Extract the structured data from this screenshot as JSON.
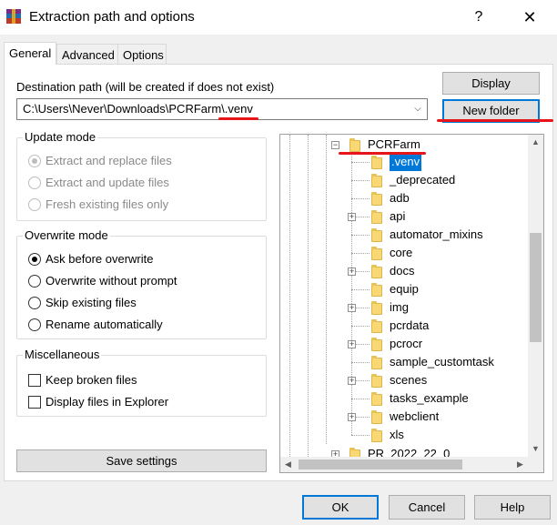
{
  "window": {
    "title": "Extraction path and options",
    "help_glyph": "?",
    "close_glyph": "✕"
  },
  "tabs": [
    {
      "label": "General",
      "active": true
    },
    {
      "label": "Advanced",
      "active": false
    },
    {
      "label": "Options",
      "active": false
    }
  ],
  "destination": {
    "label": "Destination path (will be created if does not exist)",
    "value": "C:\\Users\\Never\\Downloads\\PCRFarm\\.venv"
  },
  "buttons": {
    "display": "Display",
    "new_folder": "New folder",
    "save_settings": "Save settings",
    "ok": "OK",
    "cancel": "Cancel",
    "help": "Help"
  },
  "update_mode": {
    "title": "Update mode",
    "options": [
      {
        "label": "Extract and replace files",
        "selected": true,
        "enabled": false
      },
      {
        "label": "Extract and update files",
        "selected": false,
        "enabled": false
      },
      {
        "label": "Fresh existing files only",
        "selected": false,
        "enabled": false
      }
    ]
  },
  "overwrite_mode": {
    "title": "Overwrite mode",
    "options": [
      {
        "label": "Ask before overwrite",
        "selected": true
      },
      {
        "label": "Overwrite without prompt",
        "selected": false
      },
      {
        "label": "Skip existing files",
        "selected": false
      },
      {
        "label": "Rename automatically",
        "selected": false
      }
    ]
  },
  "miscellaneous": {
    "title": "Miscellaneous",
    "options": [
      {
        "label": "Keep broken files",
        "checked": false
      },
      {
        "label": "Display files in Explorer",
        "checked": false
      }
    ]
  },
  "tree": {
    "parent": "PCRFarm",
    "items": [
      {
        "name": ".venv",
        "selected": true,
        "expandable": false
      },
      {
        "name": "_deprecated",
        "selected": false,
        "expandable": false
      },
      {
        "name": "adb",
        "selected": false,
        "expandable": false
      },
      {
        "name": "api",
        "selected": false,
        "expandable": true
      },
      {
        "name": "automator_mixins",
        "selected": false,
        "expandable": false
      },
      {
        "name": "core",
        "selected": false,
        "expandable": false
      },
      {
        "name": "docs",
        "selected": false,
        "expandable": true
      },
      {
        "name": "equip",
        "selected": false,
        "expandable": false
      },
      {
        "name": "img",
        "selected": false,
        "expandable": true
      },
      {
        "name": "pcrdata",
        "selected": false,
        "expandable": false
      },
      {
        "name": "pcrocr",
        "selected": false,
        "expandable": true
      },
      {
        "name": "sample_customtask",
        "selected": false,
        "expandable": false
      },
      {
        "name": "scenes",
        "selected": false,
        "expandable": true
      },
      {
        "name": "tasks_example",
        "selected": false,
        "expandable": false
      },
      {
        "name": "webclient",
        "selected": false,
        "expandable": true
      },
      {
        "name": "xls",
        "selected": false,
        "expandable": false
      }
    ],
    "next_sibling": "PR_2022_22_0"
  },
  "colors": {
    "selection": "#0078d7",
    "annotation": "#e8141c",
    "folder": "#f8d775"
  }
}
